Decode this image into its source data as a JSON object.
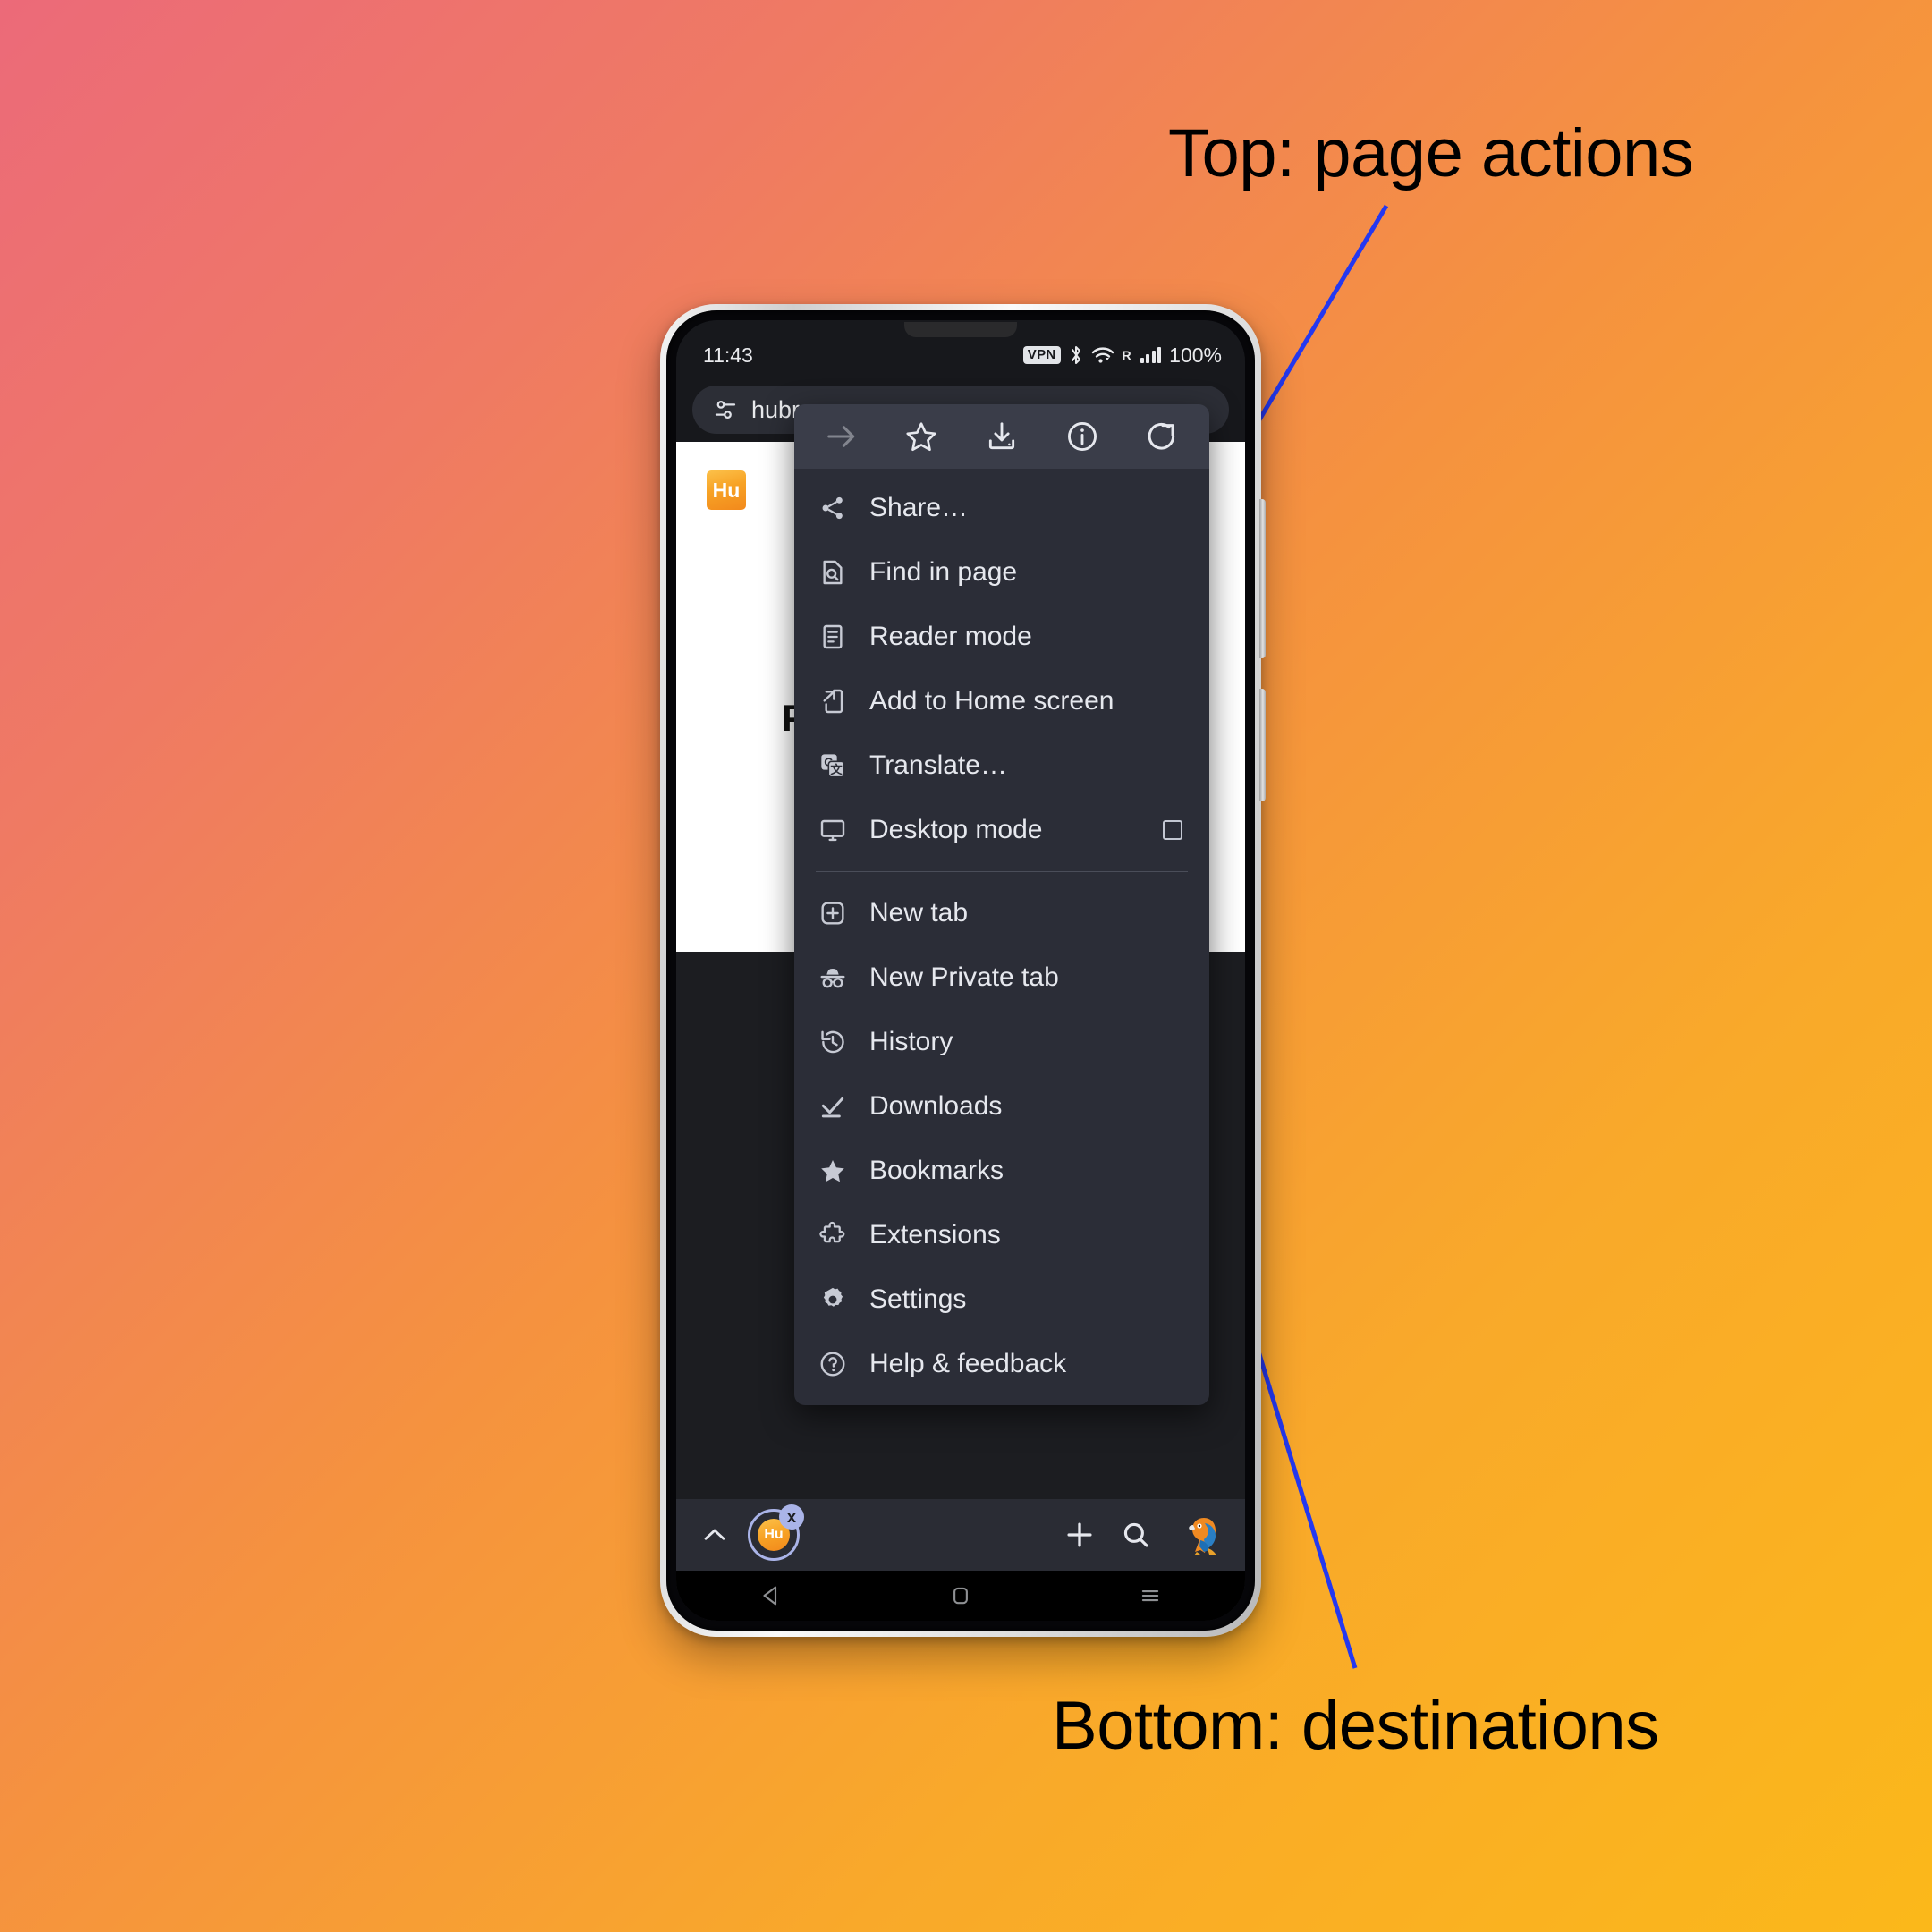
{
  "annotations": {
    "top_label": "Top: page actions",
    "bottom_label": "Bottom: destinations",
    "arrow_color": "#2438f0"
  },
  "background": {
    "gradient_start": "#ec6a79",
    "gradient_mid": "#f5923f",
    "gradient_end": "#fbb81a"
  },
  "phone": {
    "status_bar": {
      "time": "11:43",
      "vpn_badge": "VPN",
      "roaming": "R",
      "battery": "100%"
    },
    "nav_bar": {
      "back": "back-triangle",
      "home": "home-square",
      "recents": "recents-lines"
    }
  },
  "browser": {
    "url_bar": {
      "site_settings_icon": "tune-icon",
      "url_text": "hubrow"
    },
    "page": {
      "logo_text": "Hu",
      "heading": "P"
    },
    "bottom_toolbar": {
      "expand_label": "chevron-up-icon",
      "tab_favicon_text": "Hu",
      "tab_close_label": "x",
      "new_tab_label": "+",
      "search_label": "search-icon",
      "profile_label": "parrot-avatar"
    }
  },
  "menu": {
    "actions": [
      {
        "name": "forward-button",
        "icon": "arrow-right-icon",
        "disabled": true
      },
      {
        "name": "bookmark-button",
        "icon": "star-outline-icon",
        "disabled": false
      },
      {
        "name": "download-button",
        "icon": "download-icon",
        "disabled": false
      },
      {
        "name": "page-info-button",
        "icon": "info-circle-icon",
        "disabled": false
      },
      {
        "name": "reload-button",
        "icon": "reload-icon",
        "disabled": false
      }
    ],
    "group_page_actions": [
      {
        "label": "Share…",
        "icon": "share-icon"
      },
      {
        "label": "Find in page",
        "icon": "find-in-page-icon"
      },
      {
        "label": "Reader mode",
        "icon": "reader-mode-icon"
      },
      {
        "label": "Add to Home screen",
        "icon": "add-to-home-icon"
      },
      {
        "label": "Translate…",
        "icon": "translate-icon"
      },
      {
        "label": "Desktop mode",
        "icon": "desktop-icon",
        "checkbox": true,
        "checked": false
      }
    ],
    "group_destinations": [
      {
        "label": "New tab",
        "icon": "new-tab-icon"
      },
      {
        "label": "New Private tab",
        "icon": "private-tab-icon"
      },
      {
        "label": "History",
        "icon": "history-icon"
      },
      {
        "label": "Downloads",
        "icon": "downloads-icon"
      },
      {
        "label": "Bookmarks",
        "icon": "star-filled-icon"
      },
      {
        "label": "Extensions",
        "icon": "extensions-icon"
      },
      {
        "label": "Settings",
        "icon": "gear-icon"
      },
      {
        "label": "Help & feedback",
        "icon": "help-circle-icon"
      }
    ]
  }
}
